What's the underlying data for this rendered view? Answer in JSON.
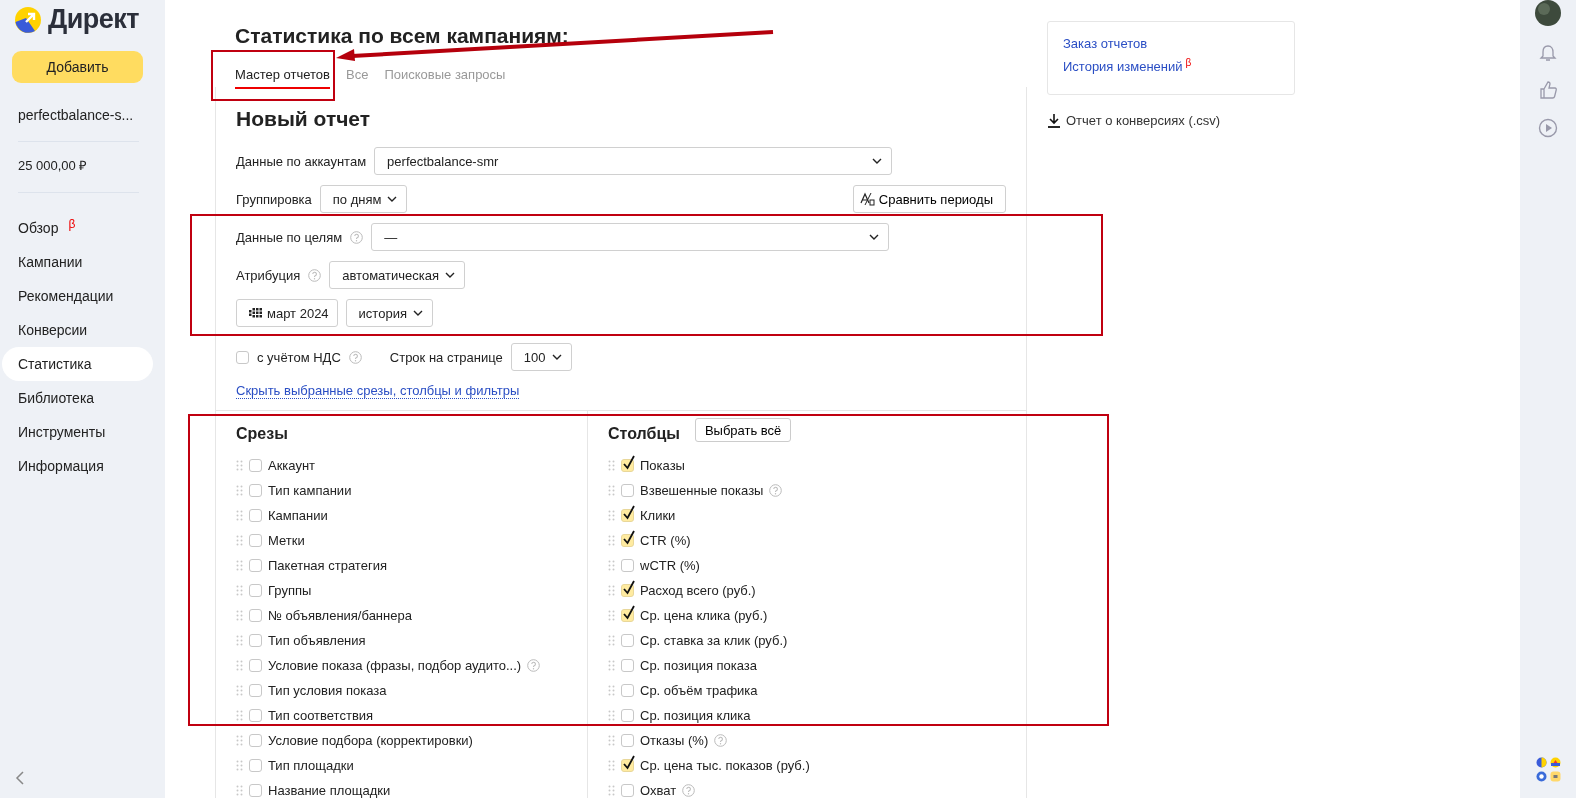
{
  "logo": {
    "text": "Директ"
  },
  "sidebar": {
    "add_button": "Добавить",
    "account": "perfectbalance-s...",
    "balance": "25 000,00 ₽",
    "items": [
      {
        "label": "Обзор",
        "badge": "β",
        "selected": false
      },
      {
        "label": "Кампании",
        "selected": false
      },
      {
        "label": "Рекомендации",
        "selected": false
      },
      {
        "label": "Конверсии",
        "selected": false
      },
      {
        "label": "Статистика",
        "selected": true
      },
      {
        "label": "Библиотека",
        "selected": false
      },
      {
        "label": "Инструменты",
        "selected": false
      },
      {
        "label": "Информация",
        "selected": false
      }
    ]
  },
  "page": {
    "title": "Статистика по всем кампаниям:",
    "tabs": [
      {
        "label": "Мастер отчетов",
        "selected": true
      },
      {
        "label": "Все",
        "selected": false
      },
      {
        "label": "Поисковые запросы",
        "selected": false
      }
    ]
  },
  "report": {
    "title": "Новый отчет",
    "account_field": {
      "label": "Данные по аккаунтам",
      "value": "perfectbalance-smr"
    },
    "grouping": {
      "label": "Группировка",
      "value": "по дням"
    },
    "compare_button": "Сравнить периоды",
    "goals_field": {
      "label": "Данные по целям",
      "value": "—"
    },
    "attribution": {
      "label": "Атрибуция",
      "value": "автоматическая"
    },
    "period": "март 2024",
    "history": "история",
    "vat": {
      "label": "с учётом НДС",
      "checked": false
    },
    "rows_per_page": {
      "label": "Строк на странице",
      "value": "100"
    },
    "hide_link": "Скрыть выбранные срезы, столбцы и фильтры"
  },
  "slices": {
    "title": "Срезы",
    "items": [
      {
        "label": "Аккаунт",
        "checked": false,
        "help": false
      },
      {
        "label": "Тип кампании",
        "checked": false,
        "help": false
      },
      {
        "label": "Кампании",
        "checked": false,
        "help": false
      },
      {
        "label": "Метки",
        "checked": false,
        "help": false
      },
      {
        "label": "Пакетная стратегия",
        "checked": false,
        "help": false
      },
      {
        "label": "Группы",
        "checked": false,
        "help": false
      },
      {
        "label": "№ объявления/баннера",
        "checked": false,
        "help": false
      },
      {
        "label": "Тип объявления",
        "checked": false,
        "help": false
      },
      {
        "label": "Условие показа (фразы, подбор аудито...)",
        "checked": false,
        "help": true
      },
      {
        "label": "Тип условия показа",
        "checked": false,
        "help": false
      },
      {
        "label": "Тип соответствия",
        "checked": false,
        "help": false
      },
      {
        "label": "Условие подбора (корректировки)",
        "checked": false,
        "help": false
      },
      {
        "label": "Тип площадки",
        "checked": false,
        "help": false
      },
      {
        "label": "Название площадки",
        "checked": false,
        "help": false
      }
    ]
  },
  "columns": {
    "title": "Столбцы",
    "select_all": "Выбрать всё",
    "items": [
      {
        "label": "Показы",
        "checked": true,
        "help": false
      },
      {
        "label": "Взвешенные показы",
        "checked": false,
        "help": true
      },
      {
        "label": "Клики",
        "checked": true,
        "help": false
      },
      {
        "label": "CTR (%)",
        "checked": true,
        "help": false
      },
      {
        "label": "wCTR (%)",
        "checked": false,
        "help": false
      },
      {
        "label": "Расход всего (руб.)",
        "checked": true,
        "help": false
      },
      {
        "label": "Ср. цена клика (руб.)",
        "checked": true,
        "help": false
      },
      {
        "label": "Ср. ставка за клик (руб.)",
        "checked": false,
        "help": false
      },
      {
        "label": "Ср. позиция показа",
        "checked": false,
        "help": false
      },
      {
        "label": "Ср. объём трафика",
        "checked": false,
        "help": false
      },
      {
        "label": "Ср. позиция клика",
        "checked": false,
        "help": false
      },
      {
        "label": "Отказы (%)",
        "checked": false,
        "help": true
      },
      {
        "label": "Ср. цена тыс. показов (руб.)",
        "checked": true,
        "help": false
      },
      {
        "label": "Охват",
        "checked": false,
        "help": true
      }
    ]
  },
  "side_panel": {
    "links": [
      {
        "label": "Заказ отчетов"
      },
      {
        "label": "История изменений",
        "badge": "β"
      }
    ],
    "download": "Отчет о конверсиях (.csv)"
  }
}
